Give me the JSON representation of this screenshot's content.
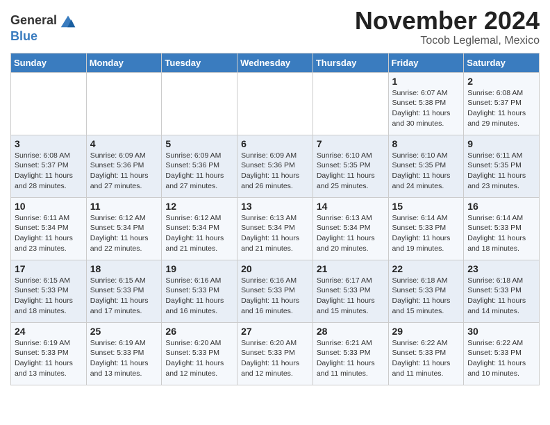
{
  "logo": {
    "general": "General",
    "blue": "Blue"
  },
  "title": "November 2024",
  "location": "Tocob Leglemal, Mexico",
  "weekdays": [
    "Sunday",
    "Monday",
    "Tuesday",
    "Wednesday",
    "Thursday",
    "Friday",
    "Saturday"
  ],
  "weeks": [
    [
      {
        "day": "",
        "info": ""
      },
      {
        "day": "",
        "info": ""
      },
      {
        "day": "",
        "info": ""
      },
      {
        "day": "",
        "info": ""
      },
      {
        "day": "",
        "info": ""
      },
      {
        "day": "1",
        "info": "Sunrise: 6:07 AM\nSunset: 5:38 PM\nDaylight: 11 hours and 30 minutes."
      },
      {
        "day": "2",
        "info": "Sunrise: 6:08 AM\nSunset: 5:37 PM\nDaylight: 11 hours and 29 minutes."
      }
    ],
    [
      {
        "day": "3",
        "info": "Sunrise: 6:08 AM\nSunset: 5:37 PM\nDaylight: 11 hours and 28 minutes."
      },
      {
        "day": "4",
        "info": "Sunrise: 6:09 AM\nSunset: 5:36 PM\nDaylight: 11 hours and 27 minutes."
      },
      {
        "day": "5",
        "info": "Sunrise: 6:09 AM\nSunset: 5:36 PM\nDaylight: 11 hours and 27 minutes."
      },
      {
        "day": "6",
        "info": "Sunrise: 6:09 AM\nSunset: 5:36 PM\nDaylight: 11 hours and 26 minutes."
      },
      {
        "day": "7",
        "info": "Sunrise: 6:10 AM\nSunset: 5:35 PM\nDaylight: 11 hours and 25 minutes."
      },
      {
        "day": "8",
        "info": "Sunrise: 6:10 AM\nSunset: 5:35 PM\nDaylight: 11 hours and 24 minutes."
      },
      {
        "day": "9",
        "info": "Sunrise: 6:11 AM\nSunset: 5:35 PM\nDaylight: 11 hours and 23 minutes."
      }
    ],
    [
      {
        "day": "10",
        "info": "Sunrise: 6:11 AM\nSunset: 5:34 PM\nDaylight: 11 hours and 23 minutes."
      },
      {
        "day": "11",
        "info": "Sunrise: 6:12 AM\nSunset: 5:34 PM\nDaylight: 11 hours and 22 minutes."
      },
      {
        "day": "12",
        "info": "Sunrise: 6:12 AM\nSunset: 5:34 PM\nDaylight: 11 hours and 21 minutes."
      },
      {
        "day": "13",
        "info": "Sunrise: 6:13 AM\nSunset: 5:34 PM\nDaylight: 11 hours and 21 minutes."
      },
      {
        "day": "14",
        "info": "Sunrise: 6:13 AM\nSunset: 5:34 PM\nDaylight: 11 hours and 20 minutes."
      },
      {
        "day": "15",
        "info": "Sunrise: 6:14 AM\nSunset: 5:33 PM\nDaylight: 11 hours and 19 minutes."
      },
      {
        "day": "16",
        "info": "Sunrise: 6:14 AM\nSunset: 5:33 PM\nDaylight: 11 hours and 18 minutes."
      }
    ],
    [
      {
        "day": "17",
        "info": "Sunrise: 6:15 AM\nSunset: 5:33 PM\nDaylight: 11 hours and 18 minutes."
      },
      {
        "day": "18",
        "info": "Sunrise: 6:15 AM\nSunset: 5:33 PM\nDaylight: 11 hours and 17 minutes."
      },
      {
        "day": "19",
        "info": "Sunrise: 6:16 AM\nSunset: 5:33 PM\nDaylight: 11 hours and 16 minutes."
      },
      {
        "day": "20",
        "info": "Sunrise: 6:16 AM\nSunset: 5:33 PM\nDaylight: 11 hours and 16 minutes."
      },
      {
        "day": "21",
        "info": "Sunrise: 6:17 AM\nSunset: 5:33 PM\nDaylight: 11 hours and 15 minutes."
      },
      {
        "day": "22",
        "info": "Sunrise: 6:18 AM\nSunset: 5:33 PM\nDaylight: 11 hours and 15 minutes."
      },
      {
        "day": "23",
        "info": "Sunrise: 6:18 AM\nSunset: 5:33 PM\nDaylight: 11 hours and 14 minutes."
      }
    ],
    [
      {
        "day": "24",
        "info": "Sunrise: 6:19 AM\nSunset: 5:33 PM\nDaylight: 11 hours and 13 minutes."
      },
      {
        "day": "25",
        "info": "Sunrise: 6:19 AM\nSunset: 5:33 PM\nDaylight: 11 hours and 13 minutes."
      },
      {
        "day": "26",
        "info": "Sunrise: 6:20 AM\nSunset: 5:33 PM\nDaylight: 11 hours and 12 minutes."
      },
      {
        "day": "27",
        "info": "Sunrise: 6:20 AM\nSunset: 5:33 PM\nDaylight: 11 hours and 12 minutes."
      },
      {
        "day": "28",
        "info": "Sunrise: 6:21 AM\nSunset: 5:33 PM\nDaylight: 11 hours and 11 minutes."
      },
      {
        "day": "29",
        "info": "Sunrise: 6:22 AM\nSunset: 5:33 PM\nDaylight: 11 hours and 11 minutes."
      },
      {
        "day": "30",
        "info": "Sunrise: 6:22 AM\nSunset: 5:33 PM\nDaylight: 11 hours and 10 minutes."
      }
    ]
  ]
}
